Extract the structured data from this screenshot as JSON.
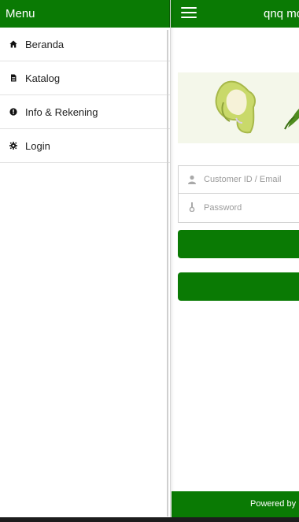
{
  "drawer": {
    "title": "Menu",
    "items": [
      {
        "label": "Beranda",
        "icon": "home-icon"
      },
      {
        "label": "Katalog",
        "icon": "document-icon"
      },
      {
        "label": "Info & Rekening",
        "icon": "info-icon"
      },
      {
        "label": "Login",
        "icon": "gear-icon"
      }
    ]
  },
  "header": {
    "title": "qnq mo"
  },
  "login": {
    "username_placeholder": "Customer ID / Email",
    "password_placeholder": "Password"
  },
  "footer": {
    "text": "Powered by"
  },
  "colors": {
    "primary": "#0a7a04",
    "banner_bg": "#f4f7ea"
  }
}
